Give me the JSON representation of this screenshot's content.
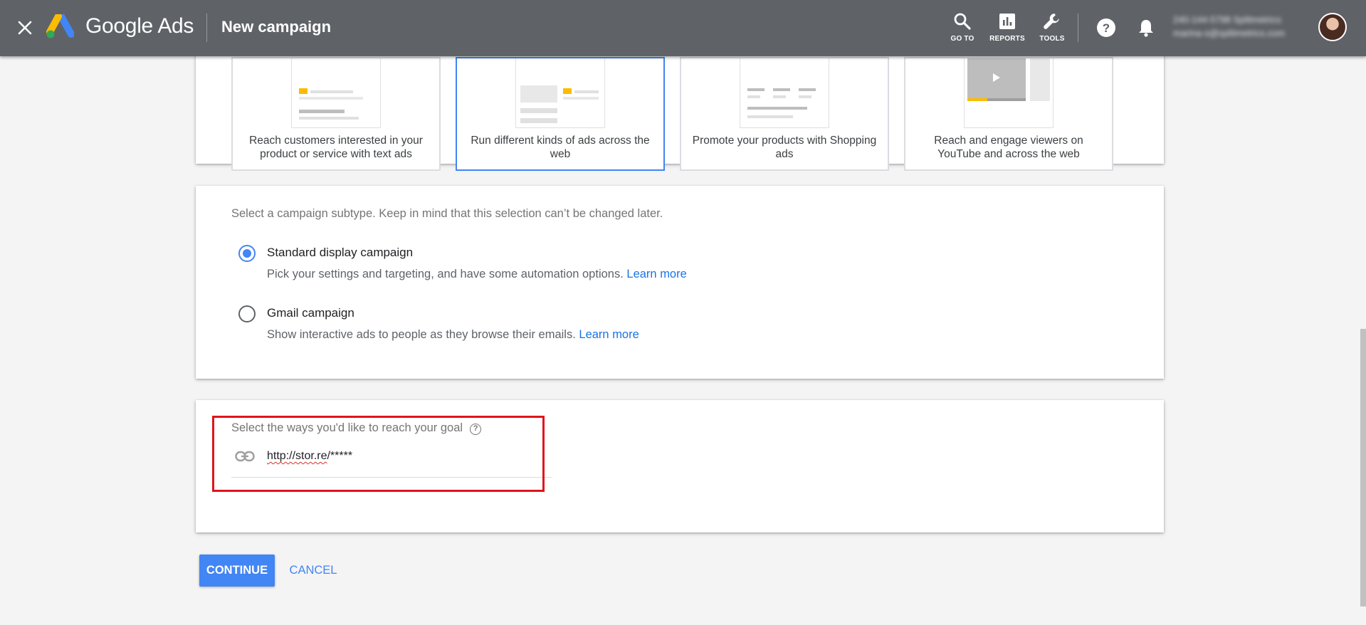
{
  "header": {
    "product_name": "Google Ads",
    "page_title": "New campaign",
    "nav": [
      {
        "label": "GO TO",
        "icon": "search-icon"
      },
      {
        "label": "REPORTS",
        "icon": "bar-chart-icon"
      },
      {
        "label": "TOOLS",
        "icon": "wrench-icon"
      }
    ],
    "account_line1": "240-144-5798 Splitmetrics",
    "account_line2": "marina-s@splitmetrics.com",
    "bar_color": "#5f6368"
  },
  "campaign_types": [
    {
      "label": "Reach customers interested in your product or service with text ads",
      "selected": false
    },
    {
      "label": "Run different kinds of ads across the web",
      "selected": true
    },
    {
      "label": "Promote your products with Shopping ads",
      "selected": false
    },
    {
      "label": "Reach and engage viewers on YouTube and across the web",
      "selected": false
    }
  ],
  "subtype": {
    "hint": "Select a campaign subtype. Keep in mind that this selection can’t be changed later.",
    "options": [
      {
        "title": "Standard display campaign",
        "description": "Pick your settings and targeting, and have some automation options.",
        "learn_more": "Learn more",
        "checked": true
      },
      {
        "title": "Gmail campaign",
        "description": "Show interactive ads to people as they browse their emails.",
        "learn_more": "Learn more",
        "checked": false
      }
    ]
  },
  "goal": {
    "hint": "Select the ways you'd like to reach your goal",
    "url_value_underlined": "http://stor.re",
    "url_value_rest": "/*****"
  },
  "actions": {
    "continue_label": "CONTINUE",
    "cancel_label": "CANCEL"
  },
  "colors": {
    "accent": "#4285f4",
    "highlight_box": "#e0141b"
  }
}
